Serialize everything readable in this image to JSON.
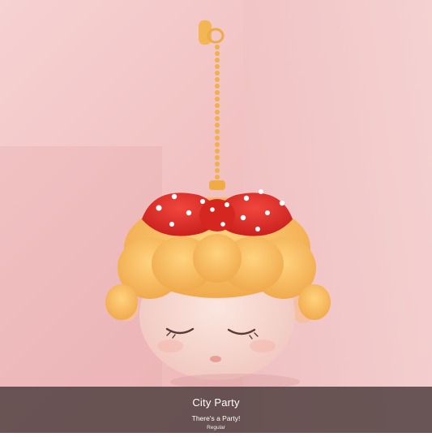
{
  "caption": {
    "title": "City Party",
    "subtitle": "There's a Party!",
    "variant": "Regular"
  },
  "colors": {
    "background": "#f2c2c4",
    "bow": "#d92a24",
    "hair": "#f5b35a",
    "skin": "#f6d8cf",
    "chain": "#f2b24e"
  }
}
